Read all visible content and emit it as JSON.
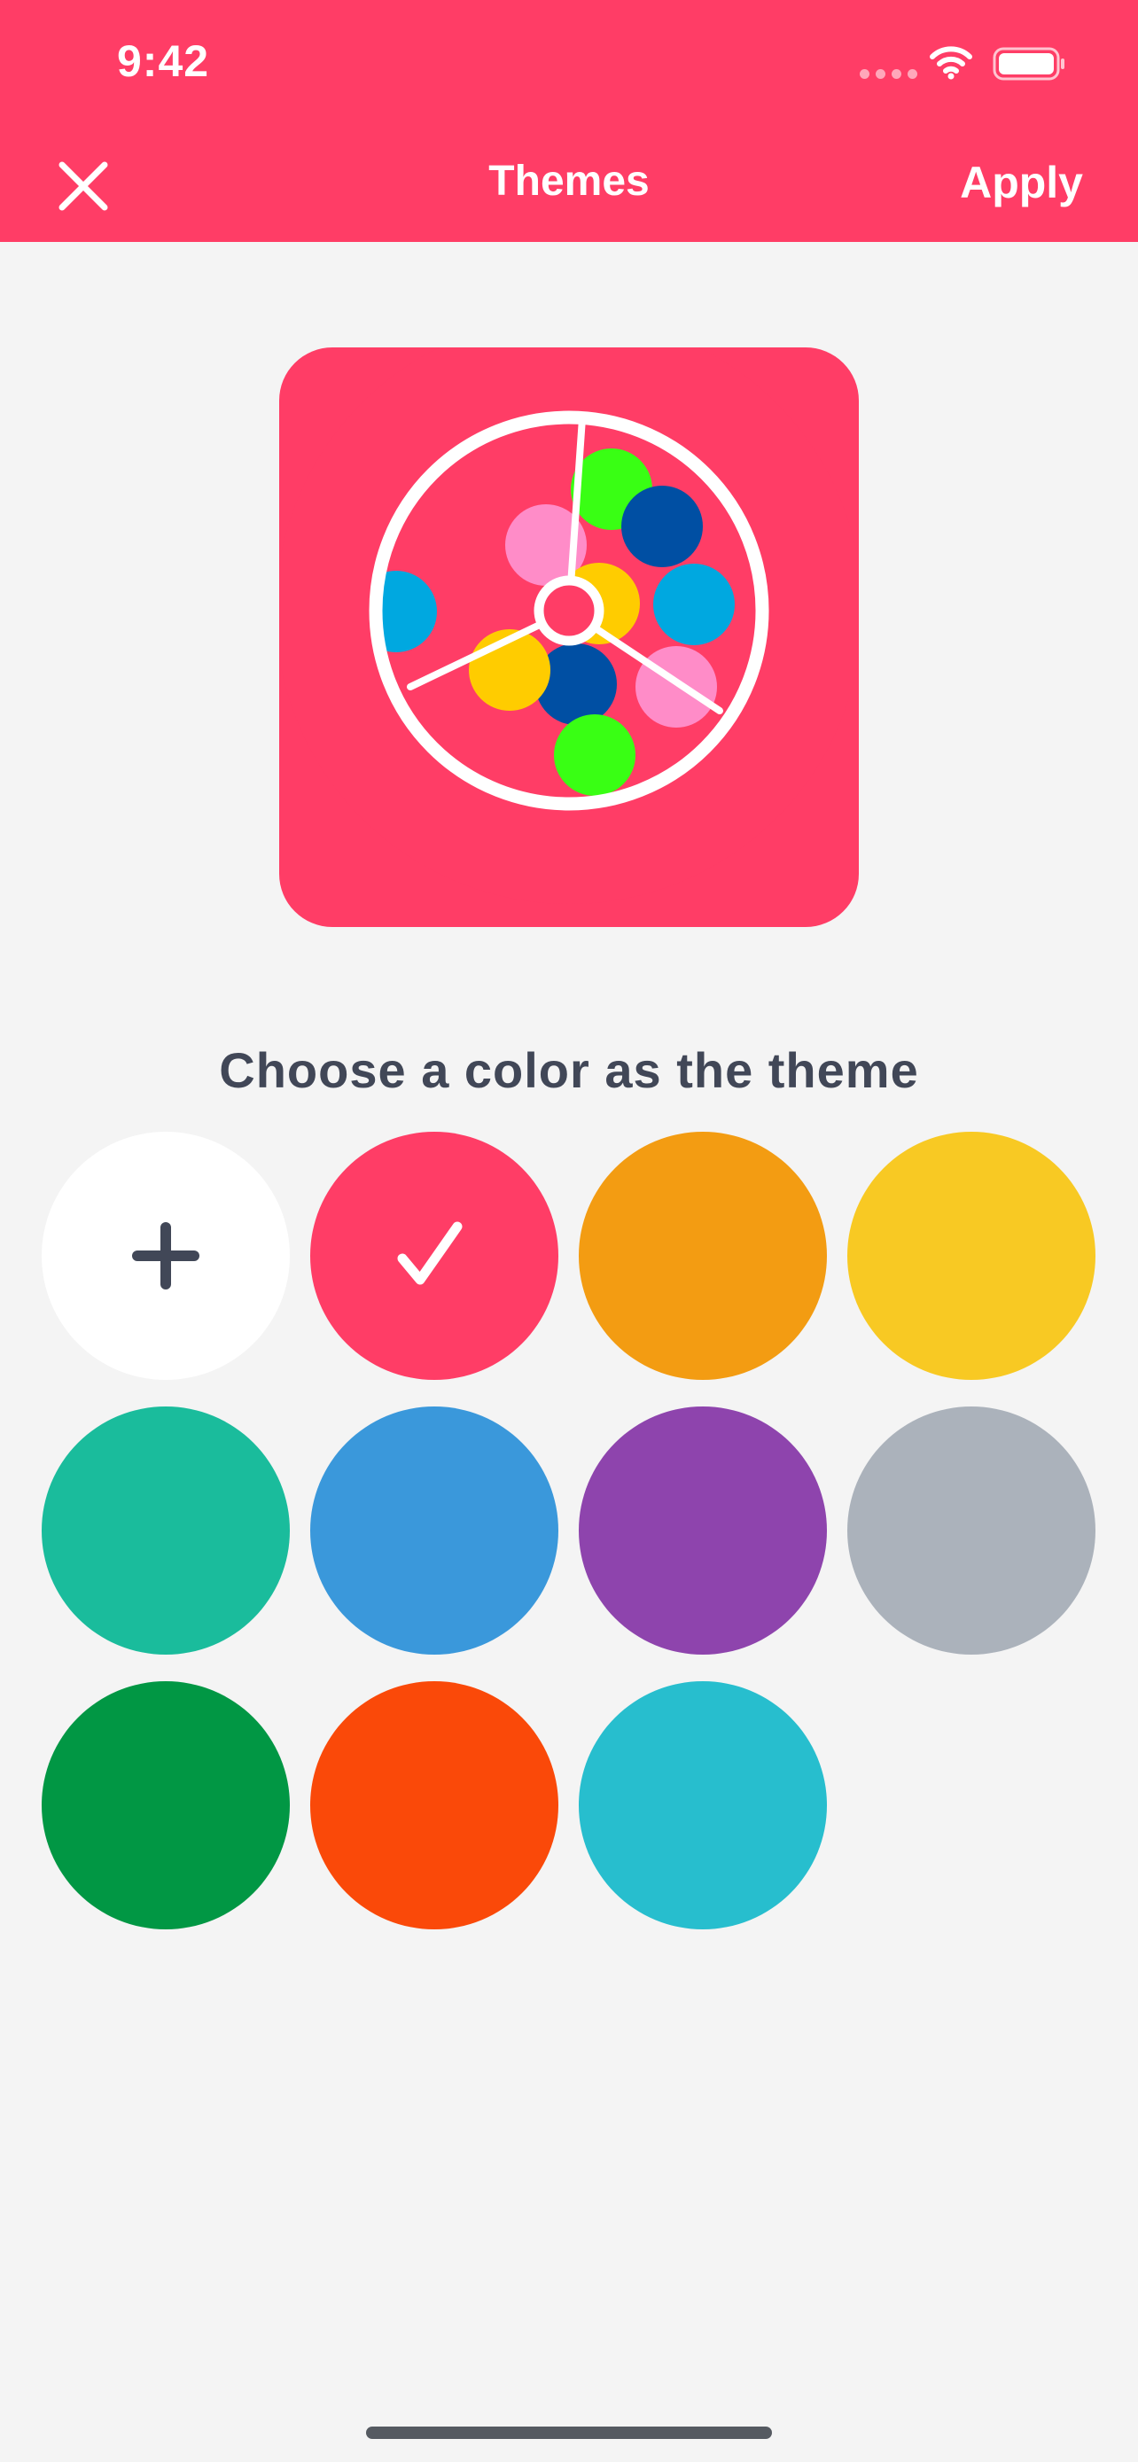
{
  "status_bar": {
    "time": "9:42",
    "icons": [
      "signal-dots-icon",
      "wifi-icon",
      "battery-icon"
    ]
  },
  "nav": {
    "close_icon": "close-icon",
    "title": "Themes",
    "apply_label": "Apply"
  },
  "preview": {
    "icon": "lottery-wheel-icon",
    "background": "#ff3d66",
    "ball_colors": [
      "#39ff14",
      "#004fa3",
      "#ff8cc8",
      "#00a8e0",
      "#ffcc00"
    ]
  },
  "prompt_text": "Choose a color as the theme",
  "swatches": [
    {
      "name": "custom",
      "color": "#ffffff",
      "icon": "plus-icon"
    },
    {
      "name": "pink-red",
      "color": "#ff3d66",
      "icon": "checkmark-icon",
      "selected": true
    },
    {
      "name": "orange",
      "color": "#f39c12"
    },
    {
      "name": "yellow",
      "color": "#f8c923"
    },
    {
      "name": "turquoise",
      "color": "#1abc9c"
    },
    {
      "name": "blue",
      "color": "#3a98db"
    },
    {
      "name": "purple",
      "color": "#8e44ad"
    },
    {
      "name": "gray",
      "color": "#abb2bb"
    },
    {
      "name": "green",
      "color": "#019744"
    },
    {
      "name": "red-orange",
      "color": "#fa4909"
    },
    {
      "name": "cyan",
      "color": "#27bece"
    }
  ],
  "accent_color": "#ff3d66"
}
